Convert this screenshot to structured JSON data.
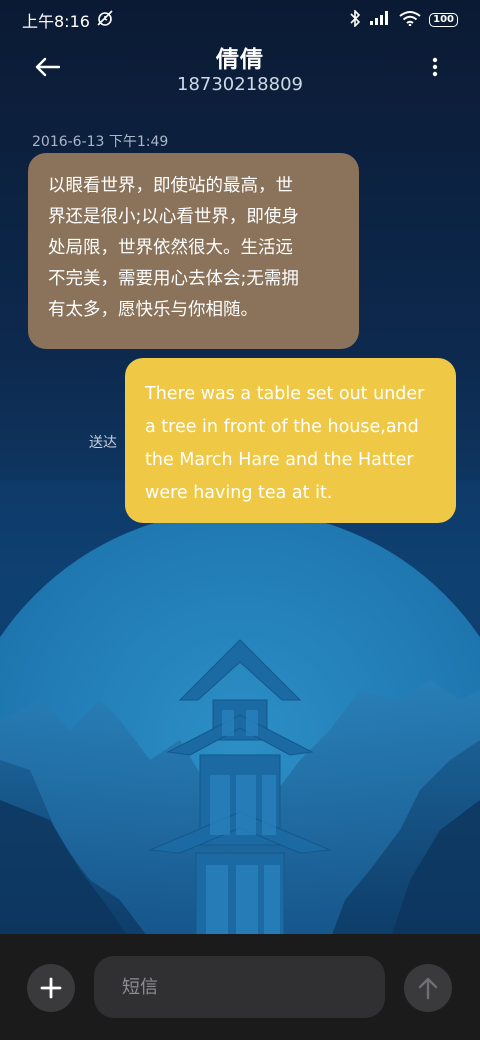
{
  "status_bar": {
    "time": "上午8:16",
    "battery": "100",
    "icons": [
      "mute-alarm-icon",
      "bluetooth-icon",
      "signal-icon",
      "wifi-icon",
      "battery-icon"
    ]
  },
  "header": {
    "contact_name": "倩倩",
    "phone_number": "18730218809",
    "back_icon": "back-arrow-icon",
    "more_icon": "more-vertical-icon"
  },
  "conversation": {
    "timestamp": "2016-6-13 下午1:49",
    "messages": [
      {
        "direction": "incoming",
        "lines": [
          "以眼看世界，即使站的最高，世",
          "界还是很小;以心看世界，即使身",
          "处局限，世界依然很大。生活远",
          "不完美，需要用心去体会;无需拥",
          "有太多，愿快乐与你相随。"
        ],
        "bubble_color": "#8a735a"
      },
      {
        "direction": "outgoing",
        "lines": [
          "There was a table set out under",
          "a tree in front of the house,and",
          "the March Hare and the Hatter",
          "were having tea at it."
        ],
        "status": "送达",
        "bubble_color": "#efc945"
      }
    ]
  },
  "compose": {
    "placeholder": "短信",
    "add_icon": "plus-icon",
    "send_icon": "send-arrow-icon"
  }
}
